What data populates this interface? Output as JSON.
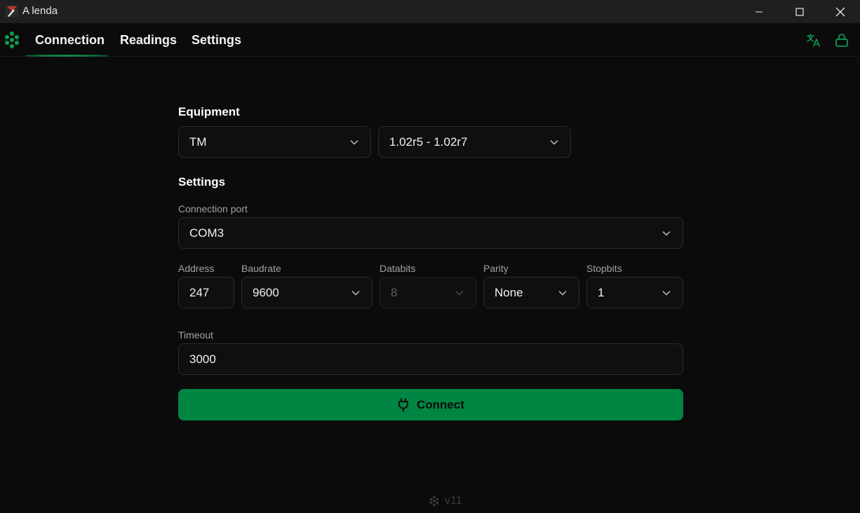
{
  "window": {
    "title": "A lenda"
  },
  "nav": {
    "tabs": [
      {
        "label": "Connection",
        "active": true
      },
      {
        "label": "Readings"
      },
      {
        "label": "Settings"
      }
    ]
  },
  "form": {
    "equipment_title": "Equipment",
    "equipment_model": "TM",
    "firmware_version": "1.02r5 - 1.02r7",
    "settings_title": "Settings",
    "port_label": "Connection port",
    "port_value": "COM3",
    "address_label": "Address",
    "address_value": "247",
    "baudrate_label": "Baudrate",
    "baudrate_value": "9600",
    "databits_label": "Databits",
    "databits_value": "8",
    "parity_label": "Parity",
    "parity_value": "None",
    "stopbits_label": "Stopbits",
    "stopbits_value": "1",
    "timeout_label": "Timeout",
    "timeout_value": "3000",
    "connect_label": "Connect"
  },
  "footer": {
    "version": "v11"
  },
  "colors": {
    "accent": "#008542",
    "background": "#0b0b0c"
  }
}
